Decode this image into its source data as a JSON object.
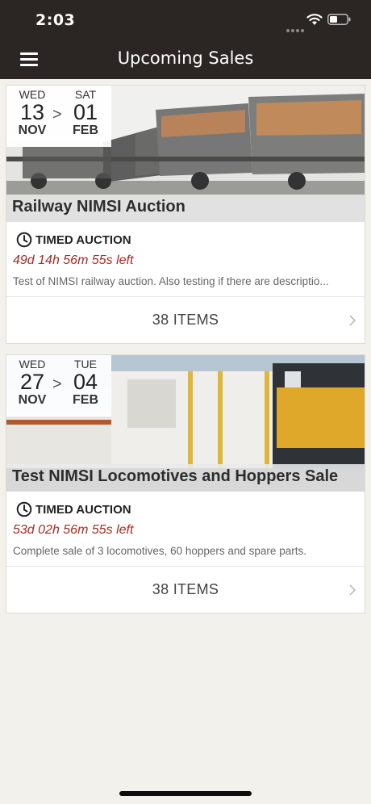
{
  "status_bar": {
    "time": "2:03"
  },
  "nav": {
    "title": "Upcoming Sales"
  },
  "sales": [
    {
      "start": {
        "day": "WED",
        "date": "13",
        "month": "NOV"
      },
      "separator": ">",
      "end": {
        "day": "SAT",
        "date": "01",
        "month": "FEB"
      },
      "title": "Railway NIMSI Auction",
      "type": "TIMED AUCTION",
      "countdown": "49d 14h 56m 55s left",
      "description": "Test of NIMSI railway auction. Also testing if there are descriptio...",
      "items_label": "38 ITEMS"
    },
    {
      "start": {
        "day": "WED",
        "date": "27",
        "month": "NOV"
      },
      "separator": ">",
      "end": {
        "day": "TUE",
        "date": "04",
        "month": "FEB"
      },
      "title": "Test NIMSI Locomotives and Hoppers Sale",
      "type": "TIMED AUCTION",
      "countdown": "53d 02h 56m 55s left",
      "description": "Complete sale of 3 locomotives, 60 hoppers and spare parts.",
      "items_label": "38 ITEMS"
    }
  ],
  "colors": {
    "header": "#2b2523",
    "countdown": "#a52c22",
    "background": "#f2f1ec"
  },
  "icons": [
    "menu-icon",
    "clock-icon",
    "chevron-right-icon",
    "wifi-icon",
    "battery-icon"
  ]
}
